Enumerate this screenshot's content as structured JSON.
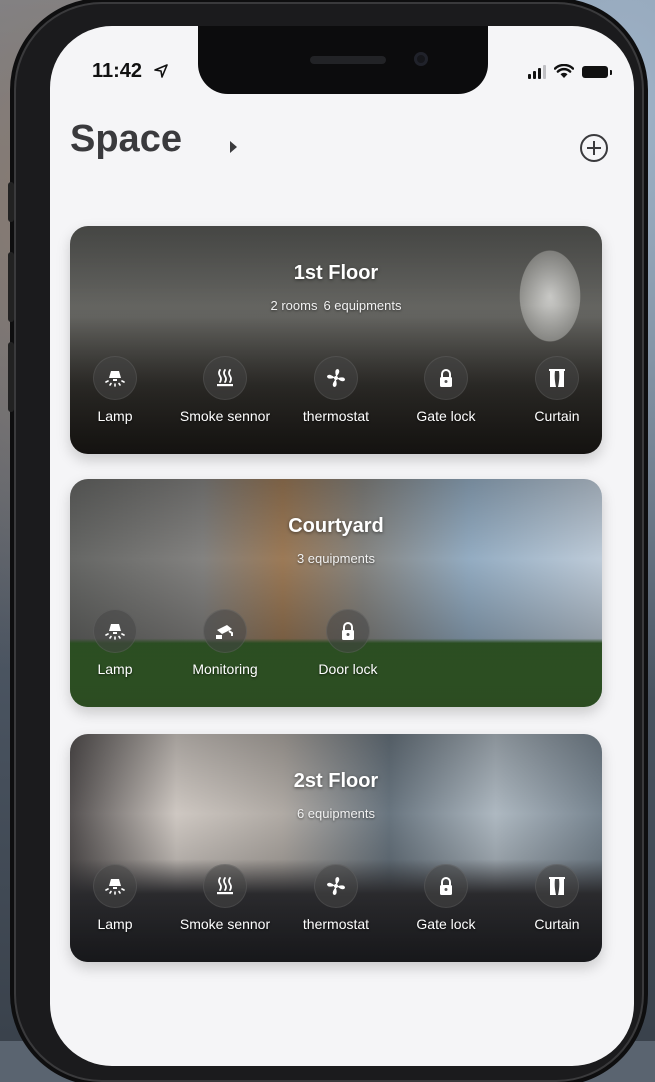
{
  "status_bar": {
    "time": "11:42"
  },
  "header": {
    "title": "Space"
  },
  "spaces": [
    {
      "name": "1st Floor",
      "rooms": "2 rooms",
      "equipments": "6 equipments",
      "devices": [
        {
          "label": "Lamp",
          "icon": "lamp-icon"
        },
        {
          "label": "Smoke sennor",
          "icon": "smoke-sensor-icon"
        },
        {
          "label": "thermostat",
          "icon": "fan-icon"
        },
        {
          "label": "Gate lock",
          "icon": "lock-icon"
        },
        {
          "label": "Curtain",
          "icon": "curtain-icon"
        }
      ]
    },
    {
      "name": "Courtyard",
      "equipments": "3 equipments",
      "devices": [
        {
          "label": "Lamp",
          "icon": "lamp-icon"
        },
        {
          "label": "Monitoring",
          "icon": "camera-icon"
        },
        {
          "label": "Door lock",
          "icon": "lock-icon"
        }
      ]
    },
    {
      "name": "2st Floor",
      "equipments": "6 equipments",
      "devices": [
        {
          "label": "Lamp",
          "icon": "lamp-icon"
        },
        {
          "label": "Smoke sennor",
          "icon": "smoke-sensor-icon"
        },
        {
          "label": "thermostat",
          "icon": "fan-icon"
        },
        {
          "label": "Gate lock",
          "icon": "lock-icon"
        },
        {
          "label": "Curtain",
          "icon": "curtain-icon"
        }
      ]
    }
  ]
}
